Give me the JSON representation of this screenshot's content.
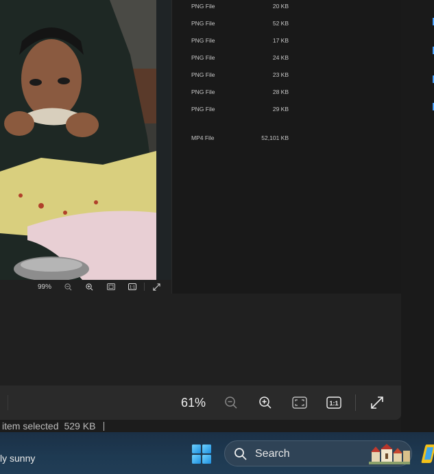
{
  "inner_viewer": {
    "zoom": "99%",
    "icons": [
      "zoom-out-icon",
      "zoom-in-icon",
      "fit-to-window-icon",
      "actual-size-icon",
      "fullscreen-icon"
    ]
  },
  "files": [
    {
      "type": "PNG File",
      "size": "20 KB"
    },
    {
      "type": "PNG File",
      "size": "52 KB"
    },
    {
      "type": "PNG File",
      "size": "17 KB"
    },
    {
      "type": "PNG File",
      "size": "24 KB"
    },
    {
      "type": "PNG File",
      "size": "23 KB"
    },
    {
      "type": "PNG File",
      "size": "28 KB"
    },
    {
      "type": "PNG File",
      "size": "29 KB"
    },
    {
      "type": "MP4 File",
      "size": "52,101 KB"
    }
  ],
  "viewer": {
    "zoom": "61%",
    "icons": [
      "zoom-out-icon",
      "zoom-in-icon",
      "fit-to-window-icon",
      "actual-size-icon",
      "fullscreen-icon"
    ]
  },
  "status": {
    "selection": "item selected",
    "size": "529 KB"
  },
  "taskbar": {
    "weather_text": "ly sunny",
    "search_label": "Search",
    "icons": [
      "windows-start-icon",
      "search-icon",
      "search-highlight-icon",
      "copilot-icon"
    ]
  },
  "colors": {
    "accent": "#4aa3ff",
    "taskbar": "#1e3a52",
    "panel": "#191919"
  }
}
